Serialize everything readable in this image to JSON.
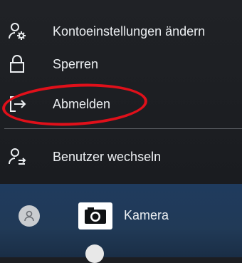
{
  "menu": {
    "items": [
      {
        "label": "Kontoeinstellungen ändern",
        "icon": "account-settings-icon"
      },
      {
        "label": "Sperren",
        "icon": "lock-icon"
      },
      {
        "label": "Abmelden",
        "icon": "sign-out-icon"
      },
      {
        "label": "Benutzer wechseln",
        "icon": "switch-user-icon"
      }
    ]
  },
  "highlight": {
    "color": "#e0101a",
    "target": "Abmelden"
  },
  "apps": [
    {
      "label": "Kamera",
      "icon": "camera-icon"
    }
  ]
}
